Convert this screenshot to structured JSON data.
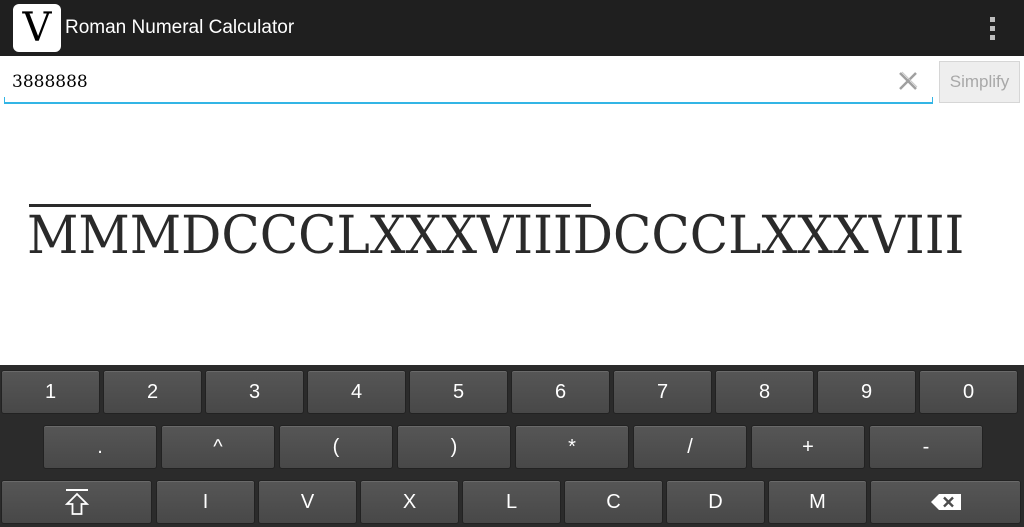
{
  "app": {
    "icon_letter": "V",
    "title": "Roman Numeral Calculator"
  },
  "input": {
    "value": "3888888"
  },
  "simplify_label": "Simplify",
  "result": {
    "overlined": "MMMDCCCLXXXVIII",
    "plain": "DCCCLXXXVIII"
  },
  "keyboard": {
    "row1": [
      "1",
      "2",
      "3",
      "4",
      "5",
      "6",
      "7",
      "8",
      "9",
      "0"
    ],
    "row2": [
      ".",
      "^",
      "(",
      ")",
      "*",
      "/",
      "+",
      "-"
    ],
    "row3": [
      "I",
      "V",
      "X",
      "L",
      "C",
      "D",
      "M"
    ]
  },
  "icons": {
    "overflow": "overflow-menu-icon",
    "clear": "clear-icon",
    "shift": "shift-icon",
    "backspace": "backspace-icon"
  },
  "colors": {
    "actionbar": "#1f1f1f",
    "accent": "#33b5e5",
    "keyboard_bg": "#2b2b2b",
    "key_face": "#4f4f4f"
  }
}
